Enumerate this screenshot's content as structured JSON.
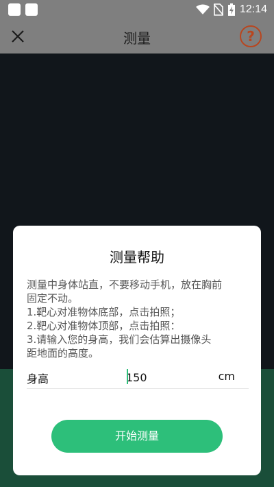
{
  "status_bar": {
    "time": "12:14",
    "icons": [
      "notification-square-icon",
      "notification-square-icon",
      "wifi-icon",
      "no-sim-icon",
      "battery-charging-icon"
    ]
  },
  "app_bar": {
    "title": "测量",
    "close_icon": "close-icon",
    "help_icon": "help-circle-icon",
    "help_glyph": "?"
  },
  "dialog": {
    "title": "测量帮助",
    "instructions": [
      "测量中身体站直，不要移动手机，放在胸前",
      "固定不动。",
      "1.靶心对准物体底部，点击拍照；",
      "2.靶心对准物体顶部，点击拍照：",
      "3.请输入您的身高，我们会估算出摄像头",
      "距地面的高度。"
    ],
    "height_label": "身高",
    "height_value": "150",
    "height_unit": "cm",
    "start_button": "开始测量"
  },
  "colors": {
    "bar_gray": "#7f7f7f",
    "camera_bg": "#11161b",
    "bottom_green": "#1a4e39",
    "accent_green": "#2dbf7a",
    "help_orange": "#b8461f"
  }
}
